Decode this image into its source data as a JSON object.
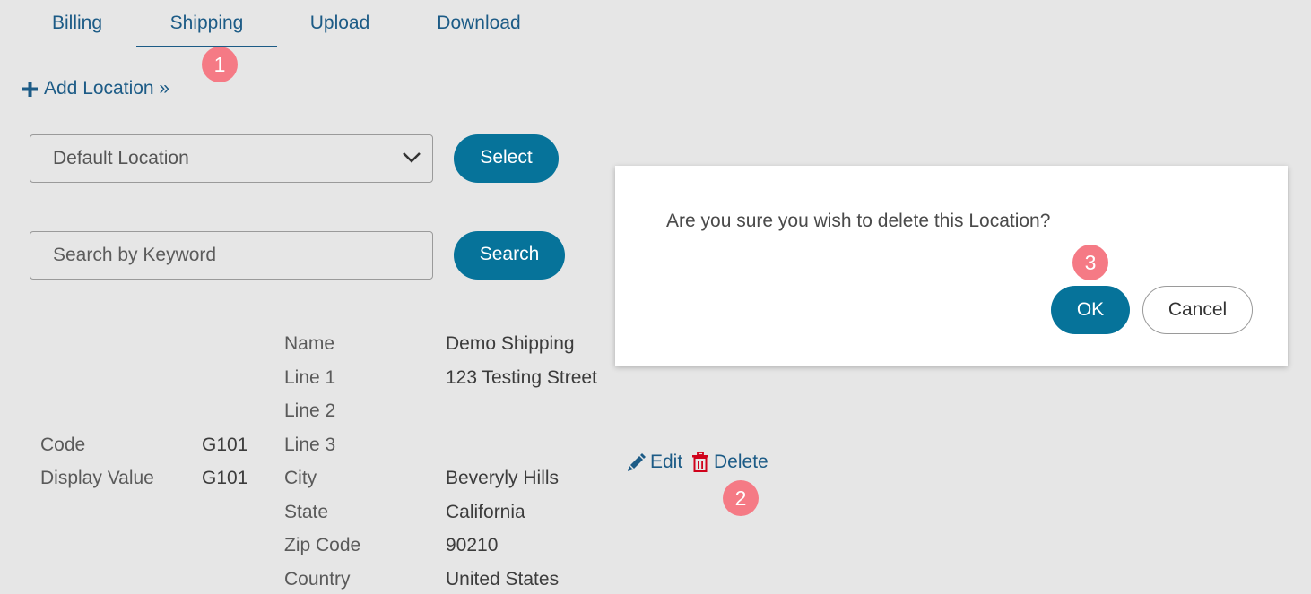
{
  "tabs": [
    {
      "label": "Billing"
    },
    {
      "label": "Shipping"
    },
    {
      "label": "Upload"
    },
    {
      "label": "Download"
    }
  ],
  "active_tab": "Shipping",
  "add_location": {
    "label": "Add Location »",
    "icon": "plus-icon"
  },
  "location_select": {
    "value": "Default Location",
    "icon": "chevron-down-icon"
  },
  "select_button": "Select",
  "search": {
    "placeholder": "Search by Keyword",
    "value": ""
  },
  "search_button": "Search",
  "location": {
    "code_label": "Code",
    "code_value": "G101",
    "display_value_label": "Display Value",
    "display_value": "G101",
    "address": [
      {
        "label": "Name",
        "value": "Demo Shipping"
      },
      {
        "label": "Line 1",
        "value": "123 Testing Street"
      },
      {
        "label": "Line 2",
        "value": ""
      },
      {
        "label": "Line 3",
        "value": ""
      },
      {
        "label": "City",
        "value": "Beveryly Hills"
      },
      {
        "label": "State",
        "value": "California"
      },
      {
        "label": "Zip Code",
        "value": "90210"
      },
      {
        "label": "Country",
        "value": "United States"
      }
    ],
    "edit_label": "Edit",
    "delete_label": "Delete"
  },
  "dialog": {
    "message": "Are you sure you wish to delete this Location?",
    "ok_label": "OK",
    "cancel_label": "Cancel"
  },
  "badges": [
    "1",
    "2",
    "3"
  ],
  "colors": {
    "accent": "#06739a",
    "link": "#1c5b86",
    "badge": "#f57a85",
    "delete_icon": "#d0021b",
    "background": "#e6e6e6"
  }
}
